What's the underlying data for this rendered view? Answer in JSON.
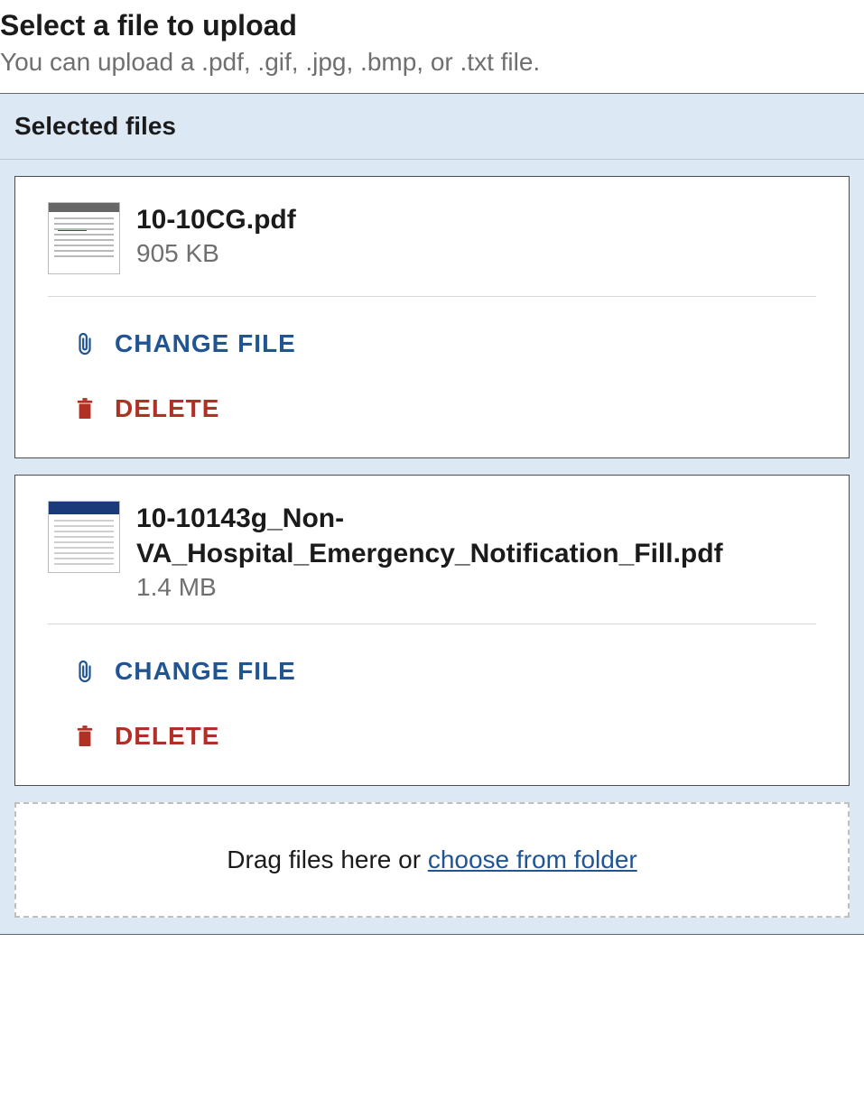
{
  "intro": {
    "title": "Select a file to upload",
    "subtitle": "You can upload a .pdf, .gif, .jpg, .bmp, or .txt file."
  },
  "selected": {
    "header": "Selected files",
    "change_label": "CHANGE FILE",
    "delete_label": "DELETE",
    "files": [
      {
        "name": "10-10CG.pdf",
        "size": "905 KB"
      },
      {
        "name": "10-10143g_Non-VA_Hospital_Emergency_Notification_Fill.pdf",
        "size": "1.4 MB"
      }
    ]
  },
  "dropzone": {
    "text_prefix": "Drag files here or ",
    "link_label": "choose from folder"
  },
  "colors": {
    "link_blue": "#205493",
    "danger_red": "#b03026",
    "panel_blue": "#dce8f4"
  }
}
